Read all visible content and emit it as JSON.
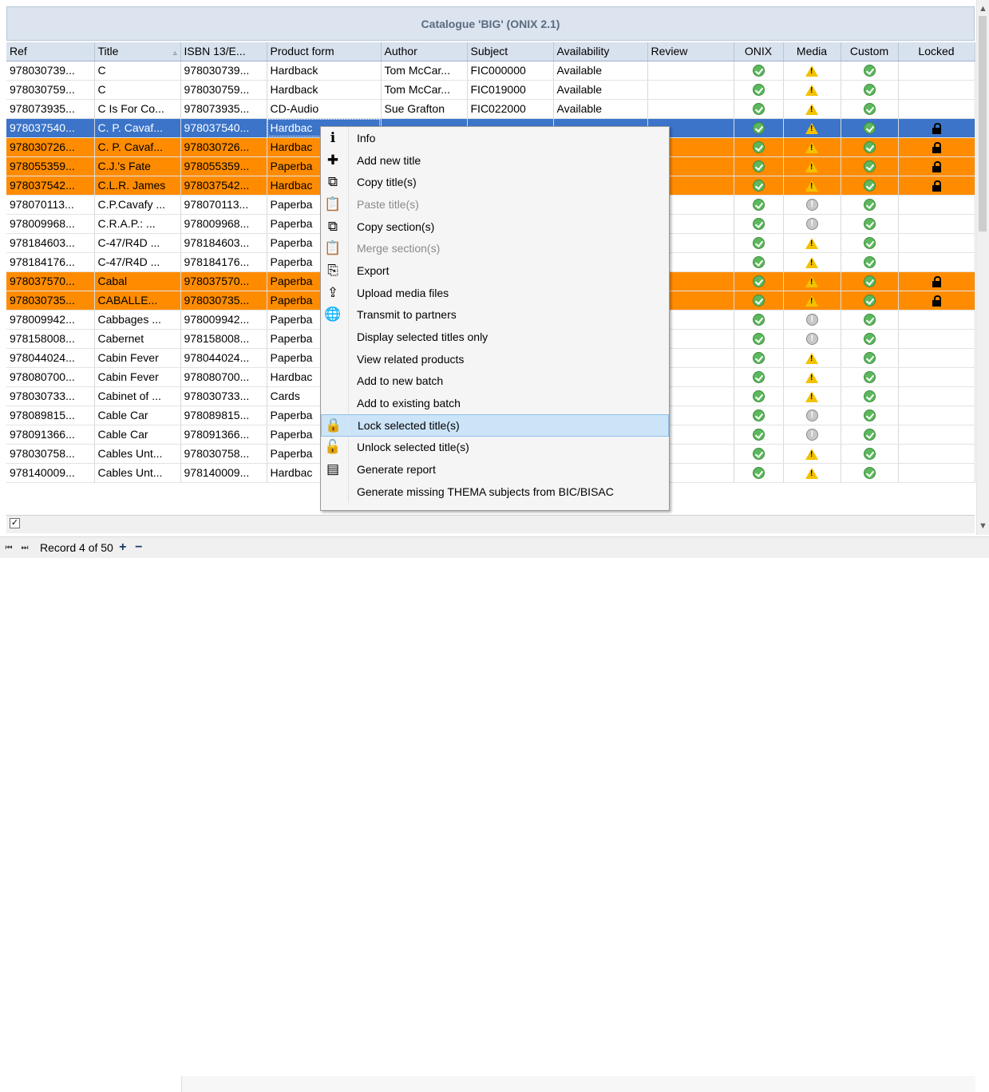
{
  "caption": "Catalogue 'BIG' (ONIX 2.1)",
  "columns": [
    {
      "label": "Ref",
      "sort": ""
    },
    {
      "label": "Title",
      "sort": "▵"
    },
    {
      "label": "ISBN 13/E...",
      "sort": ""
    },
    {
      "label": "Product form",
      "sort": ""
    },
    {
      "label": "Author",
      "sort": ""
    },
    {
      "label": "Subject",
      "sort": ""
    },
    {
      "label": "Availability",
      "sort": ""
    },
    {
      "label": "Review",
      "sort": ""
    },
    {
      "label": "ONIX",
      "sort": ""
    },
    {
      "label": "Media",
      "sort": ""
    },
    {
      "label": "Custom",
      "sort": ""
    },
    {
      "label": "Locked",
      "sort": ""
    }
  ],
  "rows": [
    {
      "ref": "978030739...",
      "title": "C",
      "isbn": "978030739...",
      "form": "Hardback",
      "author": "Tom McCar...",
      "subject": "FIC000000",
      "avail": "Available",
      "review": "",
      "onix": "ok",
      "media": "warn",
      "custom": "ok",
      "locked": false,
      "state": "normal"
    },
    {
      "ref": "978030759...",
      "title": "C",
      "isbn": "978030759...",
      "form": "Hardback",
      "author": "Tom McCar...",
      "subject": "FIC019000",
      "avail": "Available",
      "review": "",
      "onix": "ok",
      "media": "warn",
      "custom": "ok",
      "locked": false,
      "state": "normal"
    },
    {
      "ref": "978073935...",
      "title": "C Is For Co...",
      "isbn": "978073935...",
      "form": "CD-Audio",
      "author": "Sue Grafton",
      "subject": "FIC022000",
      "avail": "Available",
      "review": "",
      "onix": "ok",
      "media": "warn",
      "custom": "ok",
      "locked": false,
      "state": "normal"
    },
    {
      "ref": "978037540...",
      "title": "C. P. Cavaf...",
      "isbn": "978037540...",
      "form": "Hardbac",
      "author": "",
      "subject": "",
      "avail": "",
      "review": "",
      "onix": "ok",
      "media": "warn",
      "custom": "ok",
      "locked": true,
      "state": "sel"
    },
    {
      "ref": "978030726...",
      "title": "C. P. Cavaf...",
      "isbn": "978030726...",
      "form": "Hardbac",
      "author": "",
      "subject": "",
      "avail": "",
      "review": "",
      "onix": "ok",
      "media": "warn",
      "custom": "ok",
      "locked": true,
      "state": "lock"
    },
    {
      "ref": "978055359...",
      "title": "C.J.'s Fate",
      "isbn": "978055359...",
      "form": "Paperba",
      "author": "",
      "subject": "",
      "avail": "",
      "review": "",
      "onix": "ok",
      "media": "warn",
      "custom": "ok",
      "locked": true,
      "state": "lock"
    },
    {
      "ref": "978037542...",
      "title": "C.L.R. James",
      "isbn": "978037542...",
      "form": "Hardbac",
      "author": "",
      "subject": "",
      "avail": "",
      "review": "",
      "onix": "ok",
      "media": "warn",
      "custom": "ok",
      "locked": true,
      "state": "lock"
    },
    {
      "ref": "978070113...",
      "title": "C.P.Cavafy ...",
      "isbn": "978070113...",
      "form": "Paperba",
      "author": "",
      "subject": "",
      "avail": "",
      "review": "",
      "onix": "ok",
      "media": "grey",
      "custom": "ok",
      "locked": false,
      "state": "normal"
    },
    {
      "ref": "978009968...",
      "title": "C.R.A.P.: ...",
      "isbn": "978009968...",
      "form": "Paperba",
      "author": "",
      "subject": "",
      "avail": "",
      "review": "",
      "onix": "ok",
      "media": "grey",
      "custom": "ok",
      "locked": false,
      "state": "normal"
    },
    {
      "ref": "978184603...",
      "title": "C-47/R4D ...",
      "isbn": "978184603...",
      "form": "Paperba",
      "author": "",
      "subject": "",
      "avail": "",
      "review": "",
      "onix": "ok",
      "media": "warn",
      "custom": "ok",
      "locked": false,
      "state": "normal"
    },
    {
      "ref": "978184176...",
      "title": "C-47/R4D ...",
      "isbn": "978184176...",
      "form": "Paperba",
      "author": "",
      "subject": "",
      "avail": "",
      "review": "",
      "onix": "ok",
      "media": "warn",
      "custom": "ok",
      "locked": false,
      "state": "normal"
    },
    {
      "ref": "978037570...",
      "title": "Cabal",
      "isbn": "978037570...",
      "form": "Paperba",
      "author": "",
      "subject": "",
      "avail": "",
      "review": "",
      "onix": "ok",
      "media": "warn",
      "custom": "ok",
      "locked": true,
      "state": "lock"
    },
    {
      "ref": "978030735...",
      "title": "CABALLE...",
      "isbn": "978030735...",
      "form": "Paperba",
      "author": "",
      "subject": "",
      "avail": "",
      "review": "",
      "onix": "ok",
      "media": "warn",
      "custom": "ok",
      "locked": true,
      "state": "lock"
    },
    {
      "ref": "978009942...",
      "title": "Cabbages ...",
      "isbn": "978009942...",
      "form": "Paperba",
      "author": "",
      "subject": "",
      "avail": "",
      "review": "",
      "onix": "ok",
      "media": "grey",
      "custom": "ok",
      "locked": false,
      "state": "normal"
    },
    {
      "ref": "978158008...",
      "title": "Cabernet",
      "isbn": "978158008...",
      "form": "Paperba",
      "author": "",
      "subject": "",
      "avail": "",
      "review": "",
      "onix": "ok",
      "media": "grey",
      "custom": "ok",
      "locked": false,
      "state": "normal"
    },
    {
      "ref": "978044024...",
      "title": "Cabin Fever",
      "isbn": "978044024...",
      "form": "Paperba",
      "author": "",
      "subject": "",
      "avail": "",
      "review": "",
      "onix": "ok",
      "media": "warn",
      "custom": "ok",
      "locked": false,
      "state": "normal"
    },
    {
      "ref": "978080700...",
      "title": "Cabin Fever",
      "isbn": "978080700...",
      "form": "Hardbac",
      "author": "",
      "subject": "",
      "avail": "",
      "review": "",
      "onix": "ok",
      "media": "warn",
      "custom": "ok",
      "locked": false,
      "state": "normal"
    },
    {
      "ref": "978030733...",
      "title": "Cabinet of ...",
      "isbn": "978030733...",
      "form": "Cards",
      "author": "",
      "subject": "",
      "avail": "",
      "review": "",
      "onix": "ok",
      "media": "warn",
      "custom": "ok",
      "locked": false,
      "state": "normal"
    },
    {
      "ref": "978089815...",
      "title": "Cable Car",
      "isbn": "978089815...",
      "form": "Paperba",
      "author": "",
      "subject": "",
      "avail": "",
      "review": "",
      "onix": "ok",
      "media": "grey",
      "custom": "ok",
      "locked": false,
      "state": "normal"
    },
    {
      "ref": "978091366...",
      "title": "Cable Car",
      "isbn": "978091366...",
      "form": "Paperba",
      "author": "",
      "subject": "",
      "avail": "",
      "review": "",
      "onix": "ok",
      "media": "grey",
      "custom": "ok",
      "locked": false,
      "state": "normal"
    },
    {
      "ref": "978030758...",
      "title": "Cables Unt...",
      "isbn": "978030758...",
      "form": "Paperba",
      "author": "",
      "subject": "",
      "avail": "",
      "review": "",
      "onix": "ok",
      "media": "warn",
      "custom": "ok",
      "locked": false,
      "state": "normal"
    },
    {
      "ref": "978140009...",
      "title": "Cables Unt...",
      "isbn": "978140009...",
      "form": "Hardbac",
      "author": "",
      "subject": "",
      "avail": "",
      "review": "",
      "onix": "ok",
      "media": "warn",
      "custom": "ok",
      "locked": false,
      "state": "normal"
    }
  ],
  "context_menu": [
    {
      "label": "Info",
      "icon": "info-icon",
      "glyph": "ℹ",
      "disabled": false,
      "highlighted": false
    },
    {
      "label": "Add new title",
      "icon": "plus-icon",
      "glyph": "✚",
      "disabled": false,
      "highlighted": false
    },
    {
      "label": "Copy title(s)",
      "icon": "copy-icon",
      "glyph": "⧉",
      "disabled": false,
      "highlighted": false
    },
    {
      "label": "Paste title(s)",
      "icon": "paste-icon",
      "glyph": "📋",
      "disabled": true,
      "highlighted": false
    },
    {
      "label": "Copy section(s)",
      "icon": "copy-section-icon",
      "glyph": "⧉",
      "disabled": false,
      "highlighted": false
    },
    {
      "label": "Merge section(s)",
      "icon": "merge-icon",
      "glyph": "📋",
      "disabled": true,
      "highlighted": false
    },
    {
      "label": "Export",
      "icon": "export-icon",
      "glyph": "⎘",
      "disabled": false,
      "highlighted": false
    },
    {
      "label": "Upload media files",
      "icon": "upload-icon",
      "glyph": "⇪",
      "disabled": false,
      "highlighted": false
    },
    {
      "label": "Transmit to partners",
      "icon": "globe-icon",
      "glyph": "🌐",
      "disabled": false,
      "highlighted": false
    },
    {
      "label": "Display selected titles only",
      "icon": "",
      "glyph": "",
      "disabled": false,
      "highlighted": false
    },
    {
      "label": "View related products",
      "icon": "",
      "glyph": "",
      "disabled": false,
      "highlighted": false
    },
    {
      "label": "Add to new batch",
      "icon": "",
      "glyph": "",
      "disabled": false,
      "highlighted": false
    },
    {
      "label": "Add to existing batch",
      "icon": "",
      "glyph": "",
      "disabled": false,
      "highlighted": false
    },
    {
      "label": "Lock selected title(s)",
      "icon": "lock-icon",
      "glyph": "🔒",
      "disabled": false,
      "highlighted": true
    },
    {
      "label": "Unlock selected title(s)",
      "icon": "unlock-icon",
      "glyph": "🔓",
      "disabled": false,
      "highlighted": false
    },
    {
      "label": "Generate report",
      "icon": "report-icon",
      "glyph": "▤",
      "disabled": false,
      "highlighted": false
    },
    {
      "label": "Generate missing THEMA subjects from BIC/BISAC",
      "icon": "",
      "glyph": "",
      "disabled": false,
      "highlighted": false
    }
  ],
  "status": {
    "checkbox_checked": true,
    "record_text": "Record 4 of 50"
  },
  "colors": {
    "selected_row": "#3b74c9",
    "locked_row": "#ff8c00",
    "header_bg": "#d8e2ee"
  }
}
